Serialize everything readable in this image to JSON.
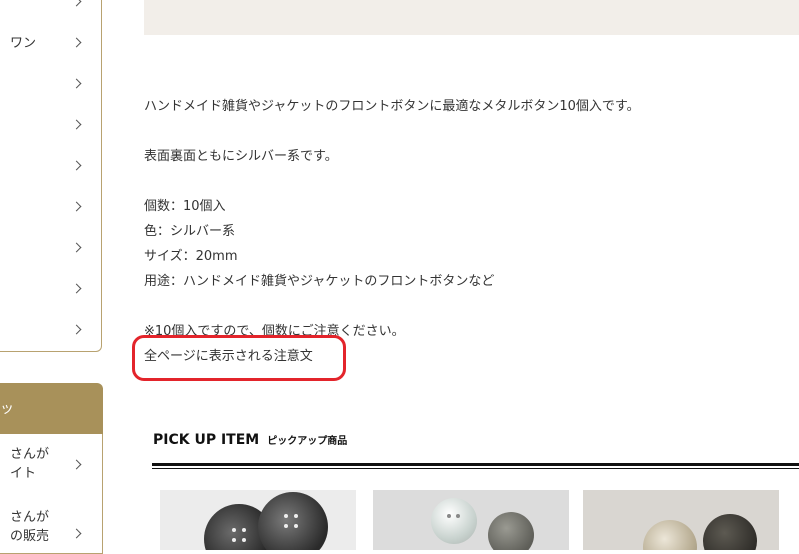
{
  "sidebar": {
    "items": [
      {
        "label": ""
      },
      {
        "label": "ワン"
      },
      {
        "label": ""
      },
      {
        "label": ""
      },
      {
        "label": ""
      },
      {
        "label": ""
      },
      {
        "label": ""
      },
      {
        "label": ""
      },
      {
        "label": ""
      }
    ],
    "section_header": "ッ",
    "sub_items": [
      {
        "label": "さんが\nイト"
      },
      {
        "label": "さんが\nの販売"
      }
    ]
  },
  "description": {
    "line1": "ハンドメイド雑貨やジャケットのフロントボタンに最適なメタルボタン10個入です。",
    "line2": "表面裏面ともにシルバー系です。",
    "spec_count": "個数：10個入",
    "spec_color": "色：シルバー系",
    "spec_size": "サイズ：20mm",
    "spec_use": "用途：ハンドメイド雑貨やジャケットのフロントボタンなど",
    "note": "※10個入ですので、個数にご注意ください。",
    "global_notice": "全ページに表示される注意文"
  },
  "pickup": {
    "title": "PICK UP ITEM",
    "subtitle": "ピックアップ商品"
  },
  "colors": {
    "accent": "#a8915a",
    "banner": "#f2eee9",
    "highlight": "#e3242b"
  }
}
